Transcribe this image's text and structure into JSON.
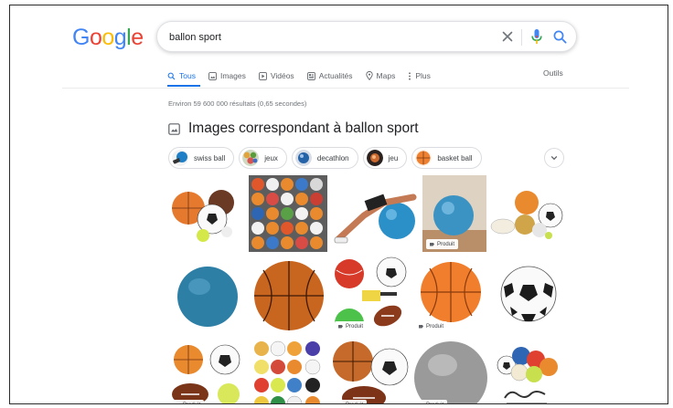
{
  "logo": "Google",
  "search": {
    "query": "ballon sport"
  },
  "tabs": [
    {
      "label": "Tous",
      "icon": "search-icon",
      "active": true
    },
    {
      "label": "Images",
      "icon": "image-icon",
      "active": false
    },
    {
      "label": "Vidéos",
      "icon": "video-icon",
      "active": false
    },
    {
      "label": "Actualités",
      "icon": "news-icon",
      "active": false
    },
    {
      "label": "Maps",
      "icon": "map-pin-icon",
      "active": false
    },
    {
      "label": "Plus",
      "icon": "more-vert-icon",
      "active": false
    }
  ],
  "tools_label": "Outils",
  "stats": "Environ 59 600 000 résultats (0,65 secondes)",
  "images_heading": "Images correspondant à ballon sport",
  "chips": [
    {
      "label": "swiss ball"
    },
    {
      "label": "jeux"
    },
    {
      "label": "decathlon"
    },
    {
      "label": "jeu"
    },
    {
      "label": "basket ball"
    }
  ],
  "product_badge": "Produit",
  "colors": {
    "accent": "#1a73e8",
    "logo_blue": "#4285f4",
    "logo_red": "#ea4335",
    "logo_yellow": "#fbbc05",
    "logo_green": "#34a853",
    "ball_blue": "#2b8fc8",
    "ball_orange": "#e87a2e"
  }
}
